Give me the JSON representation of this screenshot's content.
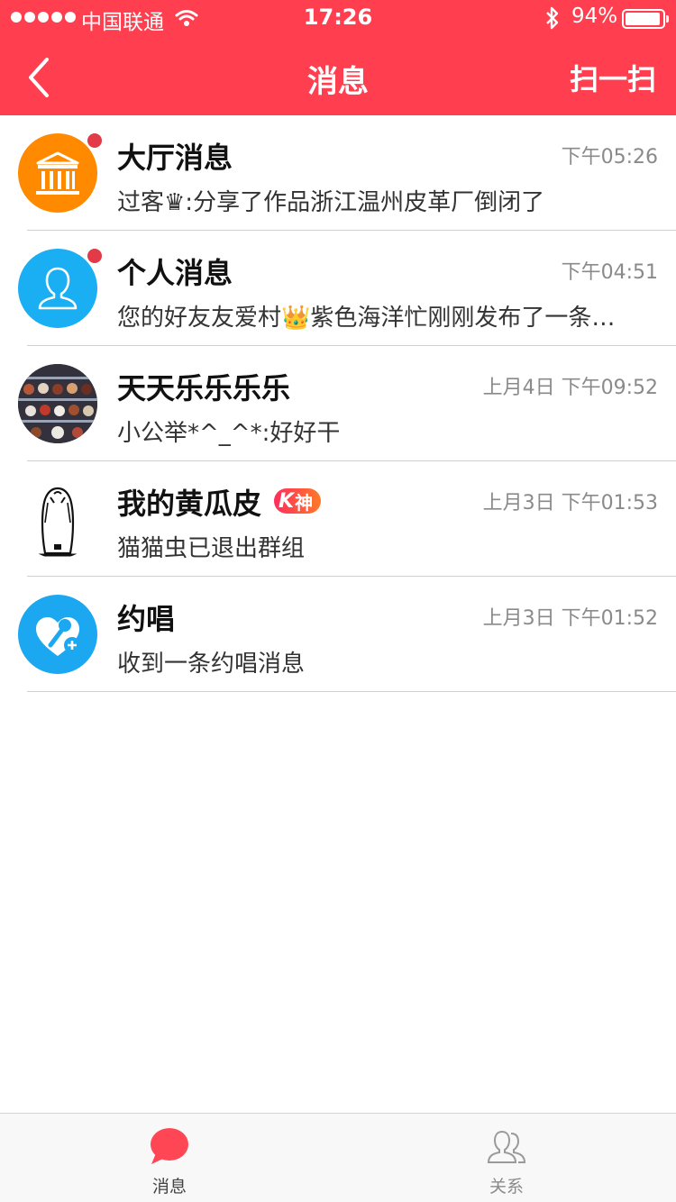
{
  "status_bar": {
    "carrier": "中国联通",
    "time": "17:26",
    "battery": "94%",
    "battery_level": 0.94
  },
  "nav": {
    "title": "消息",
    "scan_label": "扫一扫"
  },
  "conversations": [
    {
      "title": "大厅消息",
      "time": "下午05:26",
      "preview": "过客♛:分享了作品浙江温州皮革厂倒闭了",
      "unread": true,
      "avatar": "hall-icon"
    },
    {
      "title": "个人消息",
      "time": "下午04:51",
      "preview": "您的好友友爱村👑紫色海洋忙刚刚发布了一条新动态",
      "unread": true,
      "avatar": "person-icon"
    },
    {
      "title": "天天乐乐乐乐",
      "time": "上月4日 下午09:52",
      "preview": "小公举*^_^*:好好干",
      "unread": false,
      "avatar": "photo-avatar"
    },
    {
      "title": "我的黄瓜皮",
      "time": "上月3日 下午01:53",
      "preview": "猫猫虫已退出群组",
      "unread": false,
      "avatar": "sketch-avatar",
      "badge": {
        "k": "K",
        "text": "神"
      }
    },
    {
      "title": "约唱",
      "time": "上月3日 下午01:52",
      "preview": "收到一条约唱消息",
      "unread": false,
      "avatar": "microphone-heart-icon"
    }
  ],
  "tabbar": {
    "messages": "消息",
    "relations": "关系"
  },
  "colors": {
    "brand": "#ff3f4f",
    "unread_dot": "#e23a46",
    "hall_avatar": "#ff8a00",
    "blue_avatar": "#1ba8f0"
  }
}
